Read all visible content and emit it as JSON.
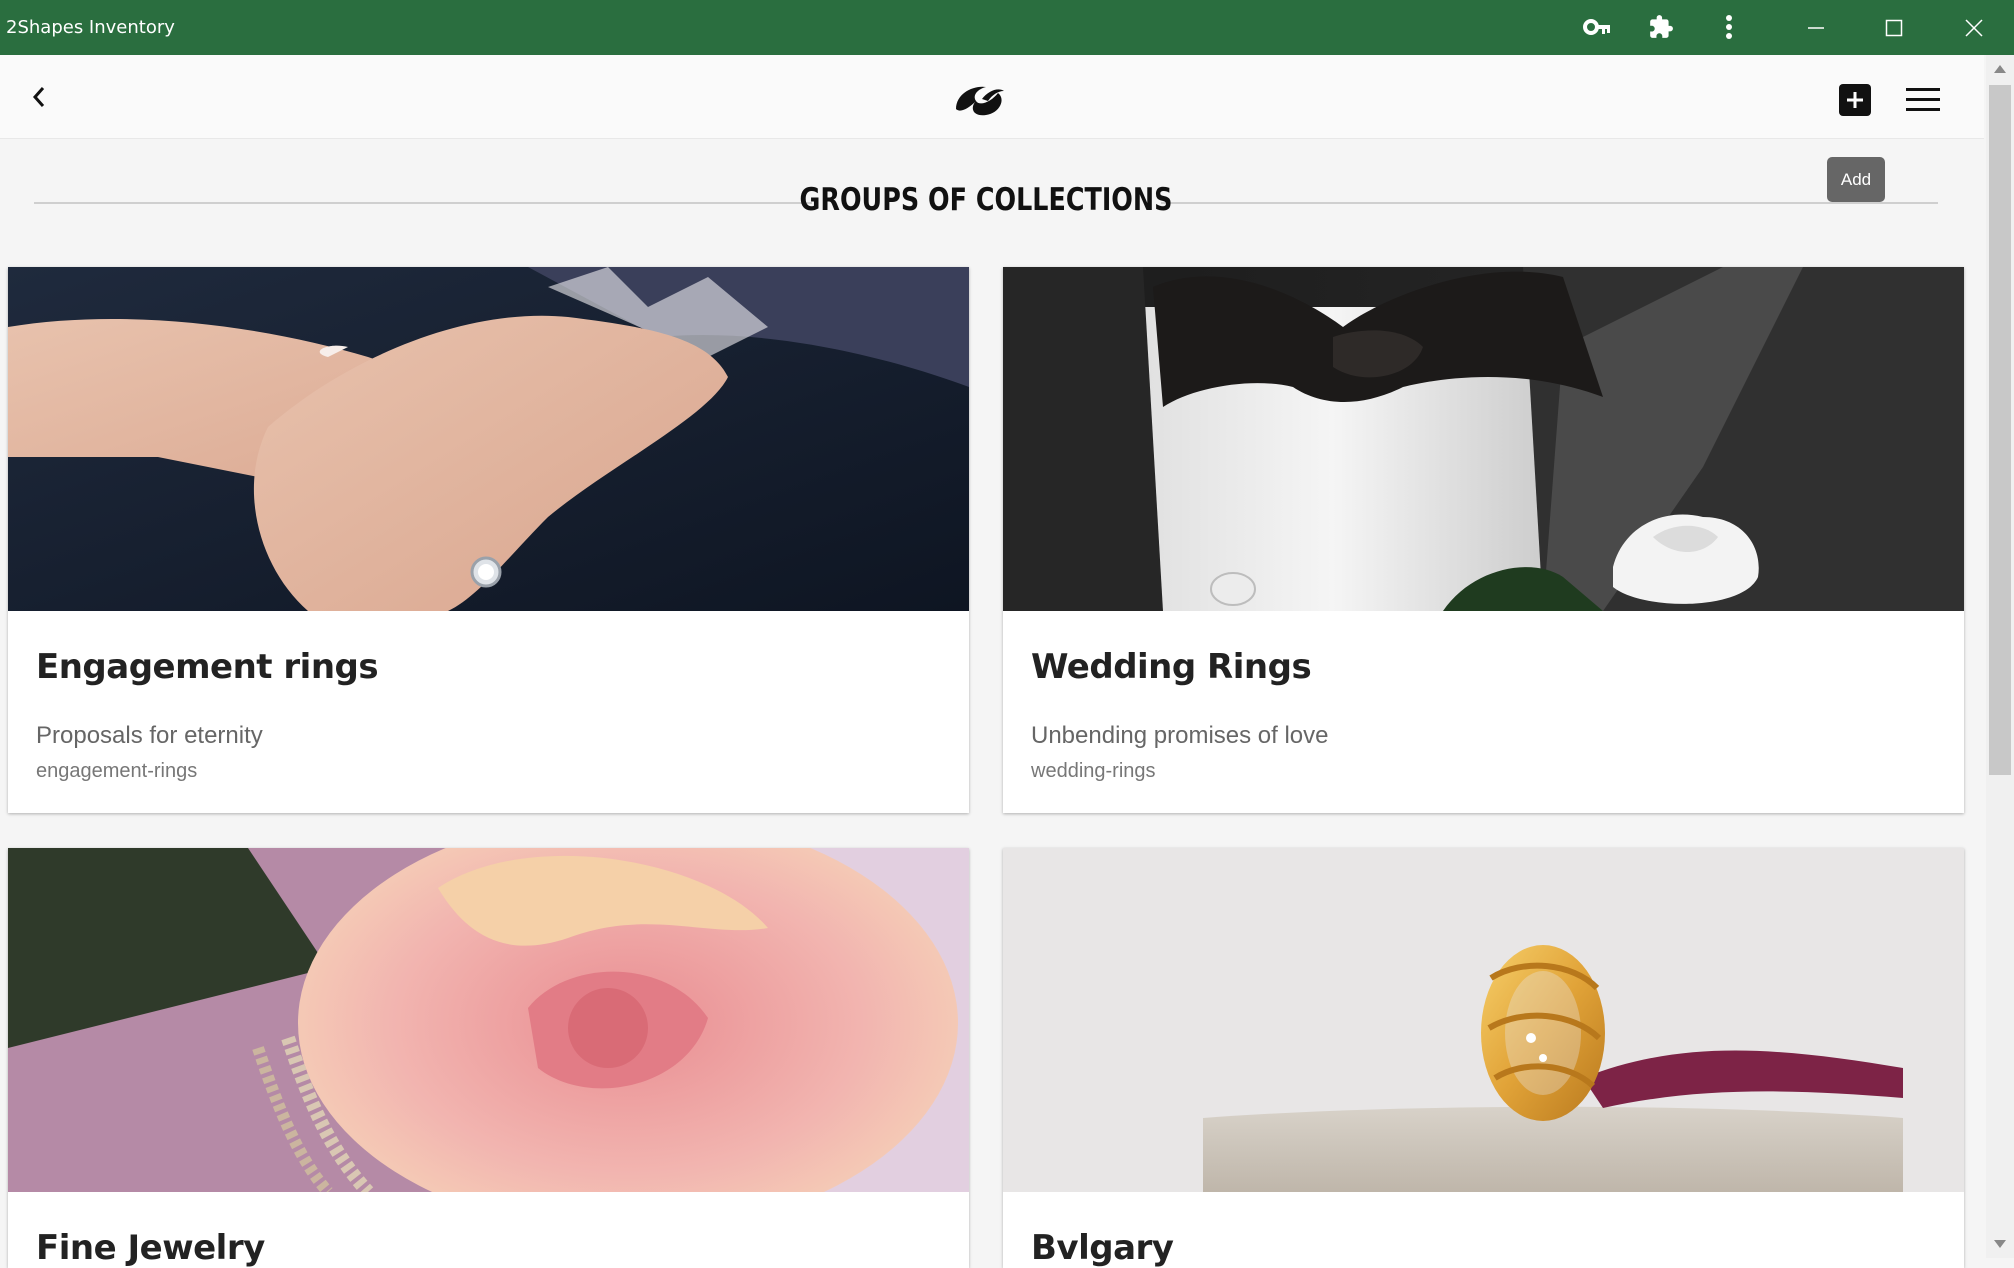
{
  "window": {
    "title": "2Shapes Inventory",
    "toolbar_icons": [
      "key-icon",
      "puzzle-icon",
      "more-vert-icon"
    ],
    "controls": [
      "minimize",
      "maximize",
      "close"
    ]
  },
  "appbar": {
    "back_icon": "chevron-left-icon",
    "logo": "2Shapes logo",
    "add_icon": "plus-box-icon",
    "menu_icon": "hamburger-icon",
    "tooltip": "Add"
  },
  "page": {
    "title": "GROUPS OF COLLECTIONS"
  },
  "cards": [
    {
      "title": "Engagement rings",
      "subtitle": "Proposals for eternity",
      "slug": "engagement-rings"
    },
    {
      "title": "Wedding Rings",
      "subtitle": "Unbending promises of love",
      "slug": "wedding-rings"
    },
    {
      "title": "Fine Jewelry",
      "subtitle": "",
      "slug": ""
    },
    {
      "title": "Bvlgary",
      "subtitle": "",
      "slug": ""
    }
  ],
  "colors": {
    "titlebar": "#2a6e3f",
    "background": "#f5f5f5",
    "card": "#ffffff"
  }
}
